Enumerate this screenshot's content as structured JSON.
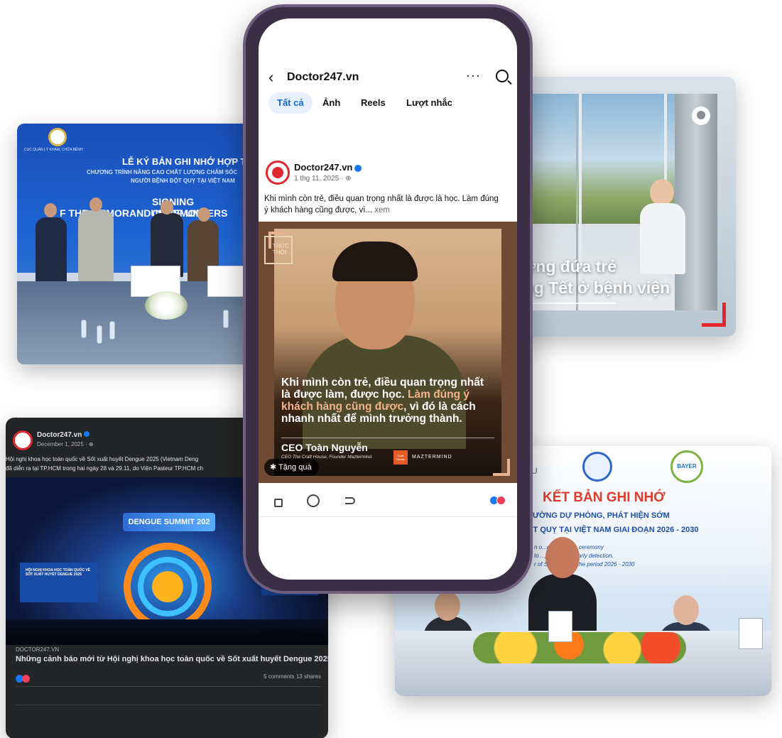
{
  "signing_card": {
    "org": "CỤC QUẢN LÝ KHÁM, CHỮA BỆNH",
    "title_vi": "LỄ KÝ BẢN GHI NHỚ HỢP TÁ",
    "subtitle_vi_1": "CHƯƠNG TRÌNH NÂNG CAO CHẤT LƯỢNG CHĂM SÓC",
    "subtitle_vi_2": "NGƯỜI BỆNH ĐỘT QUỴ TẠI VIỆT NAM",
    "title_en_1": "SIGNING CEREMONY",
    "title_en_2": "F THE MEMORANDUM OF UNDERS"
  },
  "dengue_card": {
    "page_name": "Doctor247.vn",
    "date": "December 1, 2025 · ⊕",
    "text_line_1": "Hội nghị khoa học toàn quốc về Sốt xuất huyết Dengue 2025 (Vietnam Deng",
    "text_line_2": "đã diễn ra tại TP.HCM trong hai ngày 28 và 29.11, do Viện Pasteur TP.HCM ch",
    "stage_banner": "DENGUE SUMMIT 202",
    "screen_left": "HỘI NGHỊ KHOA HỌC TOÀN QUỐC VỀ SỐT XUẤT HUYẾT DENGUE 2025",
    "link_domain": "DOCTOR247.VN",
    "link_title": "Những cảnh báo mới từ Hội nghị khoa học toàn quốc về Sốt xuất huyết Dengue 2025",
    "stats": "5 comments  13 shares",
    "colors": {
      "like": "#1877f2",
      "love": "#f33e58"
    }
  },
  "reel_card": {
    "caption_line_1": "Những đứa trẻ",
    "caption_line_2": "trông Tết ở bệnh viện",
    "accent": "#e5252c"
  },
  "mou_card": {
    "partner_logo": "BAYER",
    "prefix": "ÂU",
    "heading": "KẾT BẢN GHI NHỚ",
    "line_2": "CƯỜNG DỰ PHÒNG, PHÁT HIỆN SỚM",
    "line_3": "ỘT QUỴ TẠI VIỆT NAM GIAI ĐOẠN 2026 - 2030",
    "italic_1": "n o...ding signing ceremony",
    "italic_2": "to ...prevention, early detection,",
    "italic_3": "r of S...t Nam for the period 2026 - 2030"
  },
  "phone": {
    "header": {
      "back_icon": "chevron-left-icon",
      "title": "Doctor247.vn",
      "more": "···"
    },
    "tabs": [
      {
        "label": "Tất cả",
        "active": true
      },
      {
        "label": "Ảnh",
        "active": false
      },
      {
        "label": "Reels",
        "active": false
      },
      {
        "label": "Lượt nhắc",
        "active": false
      }
    ],
    "post": {
      "author": "Doctor247.vn",
      "date": "1 thg 11, 2025 · ⊕",
      "text": "Khi mình còn trẻ, điều quan trọng nhất là được là học. Làm đúng ý khách hàng cũng được, vì...",
      "see_more": "xem",
      "logo": "THỨC THỜI",
      "quote_part_1": "Khi mình còn trẻ, điều quan trọng nhất là được làm, được học. ",
      "quote_highlight": "Làm đúng ý khách hàng cũng được",
      "quote_part_2": ", vì đó là cách nhanh nhất để mình trưởng thành.",
      "ceo_name": "CEO Toàn Nguyễn",
      "ceo_title": "CEO The Craft House, Founder Maztermind",
      "brand_1": "Craft House",
      "brand_2": "MAZTERMIND",
      "gift_label": "Tặng quà",
      "highlight_color": "#f2b38a"
    }
  }
}
